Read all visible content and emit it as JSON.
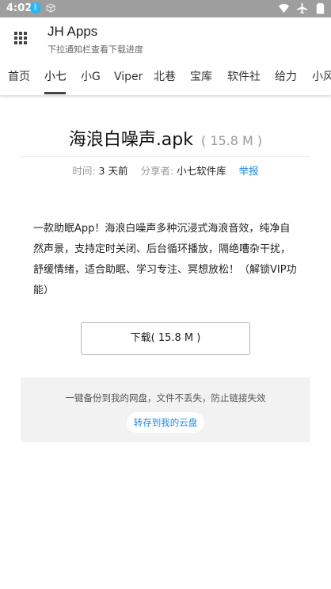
{
  "status_bar": {
    "time": "4:02",
    "icons_left": [
      "bluetooth-icon",
      "cube-icon"
    ],
    "icons_right": [
      "wifi-icon",
      "airplane-icon",
      "battery-icon"
    ]
  },
  "app_bar": {
    "title": "JH Apps",
    "subtitle": "下拉通知栏查看下载进度"
  },
  "tabs": [
    {
      "label": "首页",
      "active": false
    },
    {
      "label": "小七",
      "active": true
    },
    {
      "label": "小G",
      "active": false
    },
    {
      "label": "Viper",
      "active": false
    },
    {
      "label": "北巷",
      "active": false
    },
    {
      "label": "宝库",
      "active": false
    },
    {
      "label": "软件社",
      "active": false
    },
    {
      "label": "给力",
      "active": false
    },
    {
      "label": "小风",
      "active": false
    }
  ],
  "file": {
    "name": "海浪白噪声.apk",
    "size": "( 15.8 M )",
    "time_label": "时间:",
    "time_value": "3 天前",
    "sharer_label": "分享者:",
    "sharer_value": "小七软件库",
    "report_label": "举报",
    "description": "一款助眠App！海浪白噪声多种沉浸式海浪音效，纯净自然声景，支持定时关闭、后台循环播放，隔绝嘈杂干扰，舒缓情绪，适合助眠、学习专注、冥想放松！（解锁VIP功能）"
  },
  "download": {
    "label": "下载( 15.8 M )"
  },
  "backup": {
    "text": "一键备份到我的网盘，文件不丢失，防止链接失效",
    "button_label": "转存到我的云盘"
  },
  "colors": {
    "status_bar": "#9e9e9e",
    "accent_link": "#1e88e5",
    "bluetooth": "#29b6f6"
  }
}
